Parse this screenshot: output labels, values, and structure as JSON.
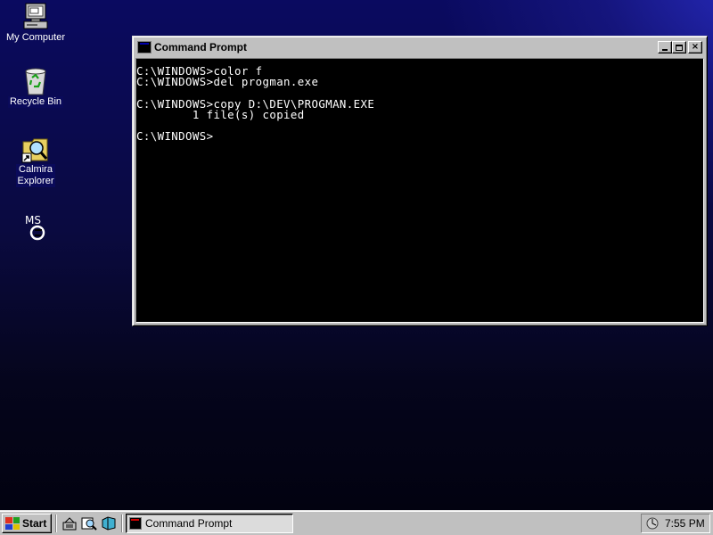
{
  "desktop": {
    "icons": [
      {
        "label": "My Computer",
        "icon": "computer-icon"
      },
      {
        "label": "Recycle Bin",
        "icon": "recycle-bin-icon"
      },
      {
        "label": "Calmira\nExplorer",
        "icon": "explorer-shortcut-icon"
      },
      {
        "label": "",
        "icon": "msdos-icon",
        "glyph_text": "MS"
      }
    ]
  },
  "window": {
    "title": "Command Prompt",
    "buttons": {
      "minimize": "minimize-icon",
      "maximize": "maximize-icon",
      "close": "×"
    },
    "console_lines": [
      "C:\\WINDOWS>color f",
      "C:\\WINDOWS>del progman.exe",
      "",
      "C:\\WINDOWS>copy D:\\DEV\\PROGMAN.EXE",
      "        1 file(s) copied",
      "",
      "C:\\WINDOWS>"
    ],
    "colors": {
      "console_bg": "#000000",
      "console_fg": "#ffffff",
      "chrome": "#c0c0c0"
    }
  },
  "taskbar": {
    "start_label": "Start",
    "quick_launch": [
      "internet-icon",
      "find-icon",
      "file-manager-icon"
    ],
    "tasks": [
      {
        "label": "Command Prompt",
        "active": true
      }
    ],
    "clock": "7:55 PM",
    "tray_icons": [
      "system-tray-icon"
    ]
  }
}
